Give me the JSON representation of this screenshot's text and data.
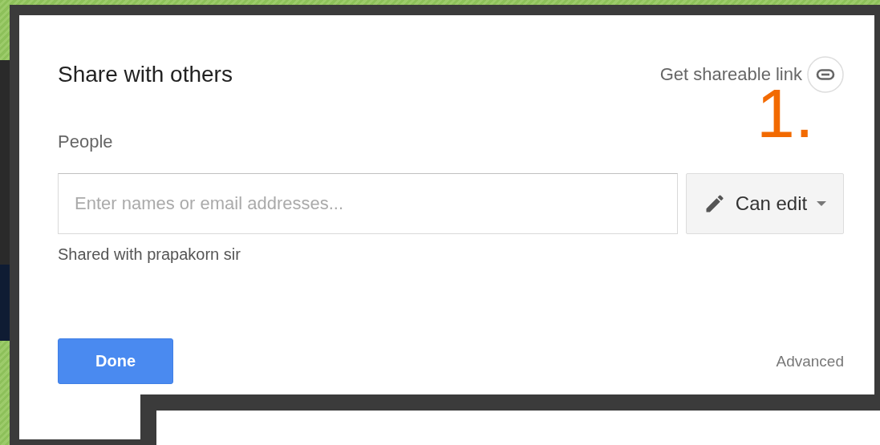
{
  "dialog": {
    "title": "Share with others",
    "shareable_link": "Get shareable link",
    "people_label": "People",
    "people_field": {
      "placeholder": "Enter names or email addresses..."
    },
    "permission_button": "Can edit",
    "shared_with": "Shared with prapakorn sir",
    "done_button": "Done",
    "advanced_link": "Advanced"
  },
  "annotation": "1."
}
